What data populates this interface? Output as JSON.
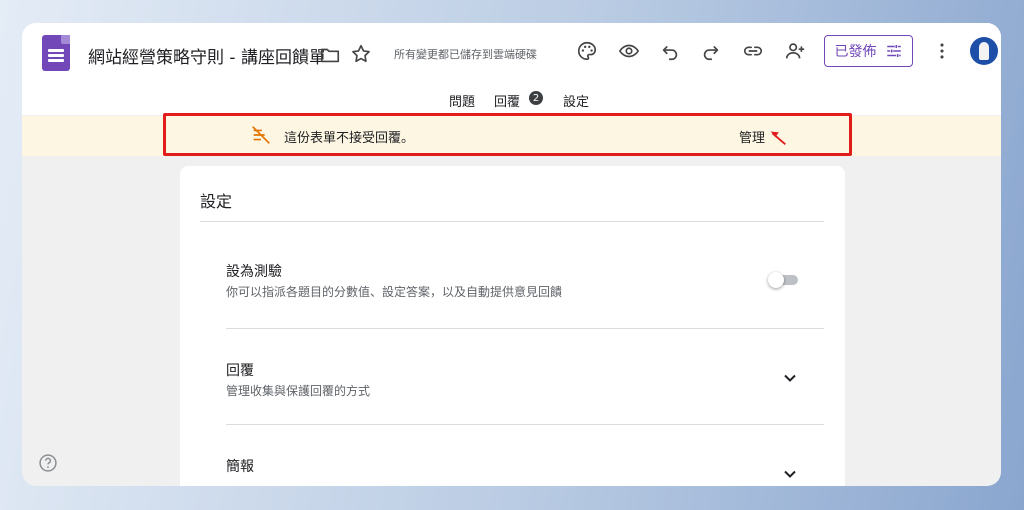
{
  "header": {
    "doc_title": "網站經營策略守則 - 講座回饋單",
    "save_status": "所有變更都已儲存到雲端硬碟",
    "publish_label": "已發佈"
  },
  "tabs": [
    {
      "label": "問題"
    },
    {
      "label": "回覆",
      "badge": "2"
    },
    {
      "label": "設定"
    }
  ],
  "banner": {
    "message": "這份表單不接受回覆。",
    "manage_label": "管理",
    "highlight_color": "#e21b1b"
  },
  "settings": {
    "title": "設定",
    "sections": [
      {
        "title": "設為測驗",
        "desc": "你可以指派各題目的分數值、設定答案，以及自動提供意見回饋"
      },
      {
        "title": "回覆",
        "desc": "管理收集與保護回覆的方式"
      },
      {
        "title": "簡報"
      }
    ]
  },
  "colors": {
    "brand": "#7248b9",
    "banner_bg": "#fdf6e3"
  },
  "icons": [
    "forms-logo-icon",
    "folder-icon",
    "star-icon",
    "palette-icon",
    "eye-icon",
    "undo-icon",
    "redo-icon",
    "link-icon",
    "add-person-icon",
    "tune-icon",
    "more-vert-icon",
    "no-responses-icon",
    "chevron-down-icon",
    "help-icon"
  ]
}
